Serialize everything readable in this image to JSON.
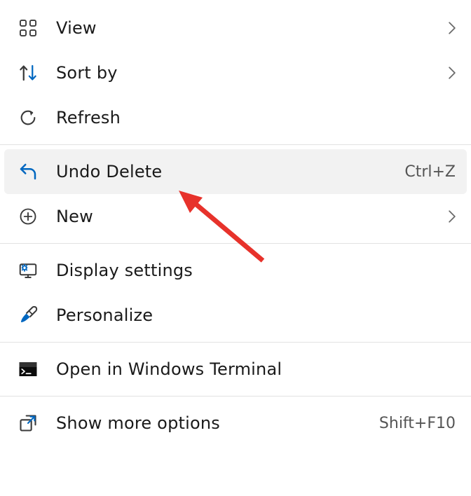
{
  "menu": {
    "items": [
      {
        "id": "view",
        "label": "View",
        "has_submenu": true
      },
      {
        "id": "sort-by",
        "label": "Sort by",
        "has_submenu": true
      },
      {
        "id": "refresh",
        "label": "Refresh",
        "has_submenu": false
      },
      {
        "id": "undo-delete",
        "label": "Undo Delete",
        "accelerator": "Ctrl+Z",
        "highlighted": true
      },
      {
        "id": "new",
        "label": "New",
        "has_submenu": true
      },
      {
        "id": "display-settings",
        "label": "Display settings"
      },
      {
        "id": "personalize",
        "label": "Personalize"
      },
      {
        "id": "open-terminal",
        "label": "Open in Windows Terminal"
      },
      {
        "id": "show-more",
        "label": "Show more options",
        "accelerator": "Shift+F10"
      }
    ]
  },
  "colors": {
    "accent": "#0067c0",
    "text": "#1a1a1a",
    "annotation": "#e7322b"
  }
}
